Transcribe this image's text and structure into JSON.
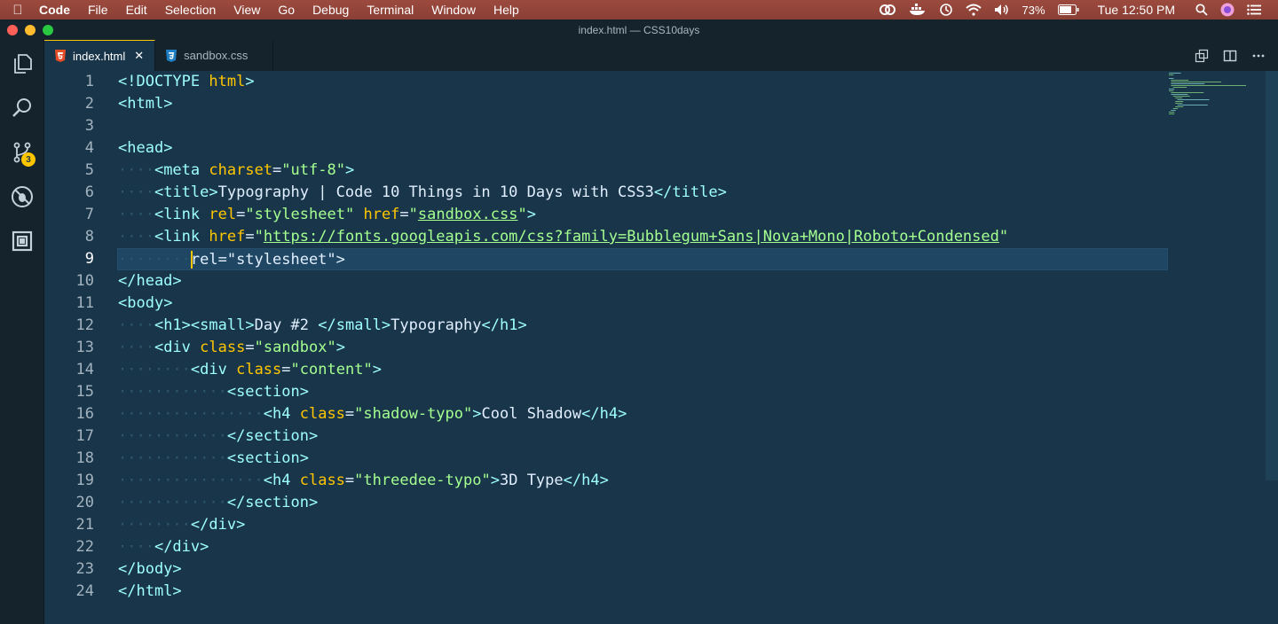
{
  "menubar": {
    "app": "Code",
    "items": [
      "File",
      "Edit",
      "Selection",
      "View",
      "Go",
      "Debug",
      "Terminal",
      "Window",
      "Help"
    ],
    "battery": "73%",
    "clock": "Tue 12:50 PM"
  },
  "window": {
    "title": "index.html — CSS10days"
  },
  "activity": {
    "scm_badge": "3"
  },
  "tabs": [
    {
      "label": "index.html",
      "icon": "html5-file-icon",
      "active": true
    },
    {
      "label": "sandbox.css",
      "icon": "css3-file-icon",
      "active": false
    }
  ],
  "editor": {
    "current_line": 9,
    "line_numbers": [
      "1",
      "2",
      "3",
      "4",
      "5",
      "6",
      "7",
      "8",
      "9",
      "10",
      "11",
      "12",
      "13",
      "14",
      "15",
      "16",
      "17",
      "18",
      "19",
      "20",
      "21",
      "22",
      "23",
      "24"
    ],
    "lines": [
      "<!DOCTYPE html>",
      "<html>",
      "",
      "<head>",
      "    <meta charset=\"utf-8\">",
      "    <title>Typography | Code 10 Things in 10 Days with CSS3</title>",
      "    <link rel=\"stylesheet\" href=\"sandbox.css\">",
      "    <link href=\"https://fonts.googleapis.com/css?family=Bubblegum+Sans|Nova+Mono|Roboto+Condensed\"",
      "        rel=\"stylesheet\">",
      "</head>",
      "<body>",
      "    <h1><small>Day #2 </small>Typography</h1>",
      "    <div class=\"sandbox\">",
      "        <div class=\"content\">",
      "            <section>",
      "                <h4 class=\"shadow-typo\">Cool Shadow</h4>",
      "            </section>",
      "            <section>",
      "                <h4 class=\"threedee-typo\">3D Type</h4>",
      "            </section>",
      "        </div>",
      "    </div>",
      "</body>",
      "</html>"
    ]
  }
}
